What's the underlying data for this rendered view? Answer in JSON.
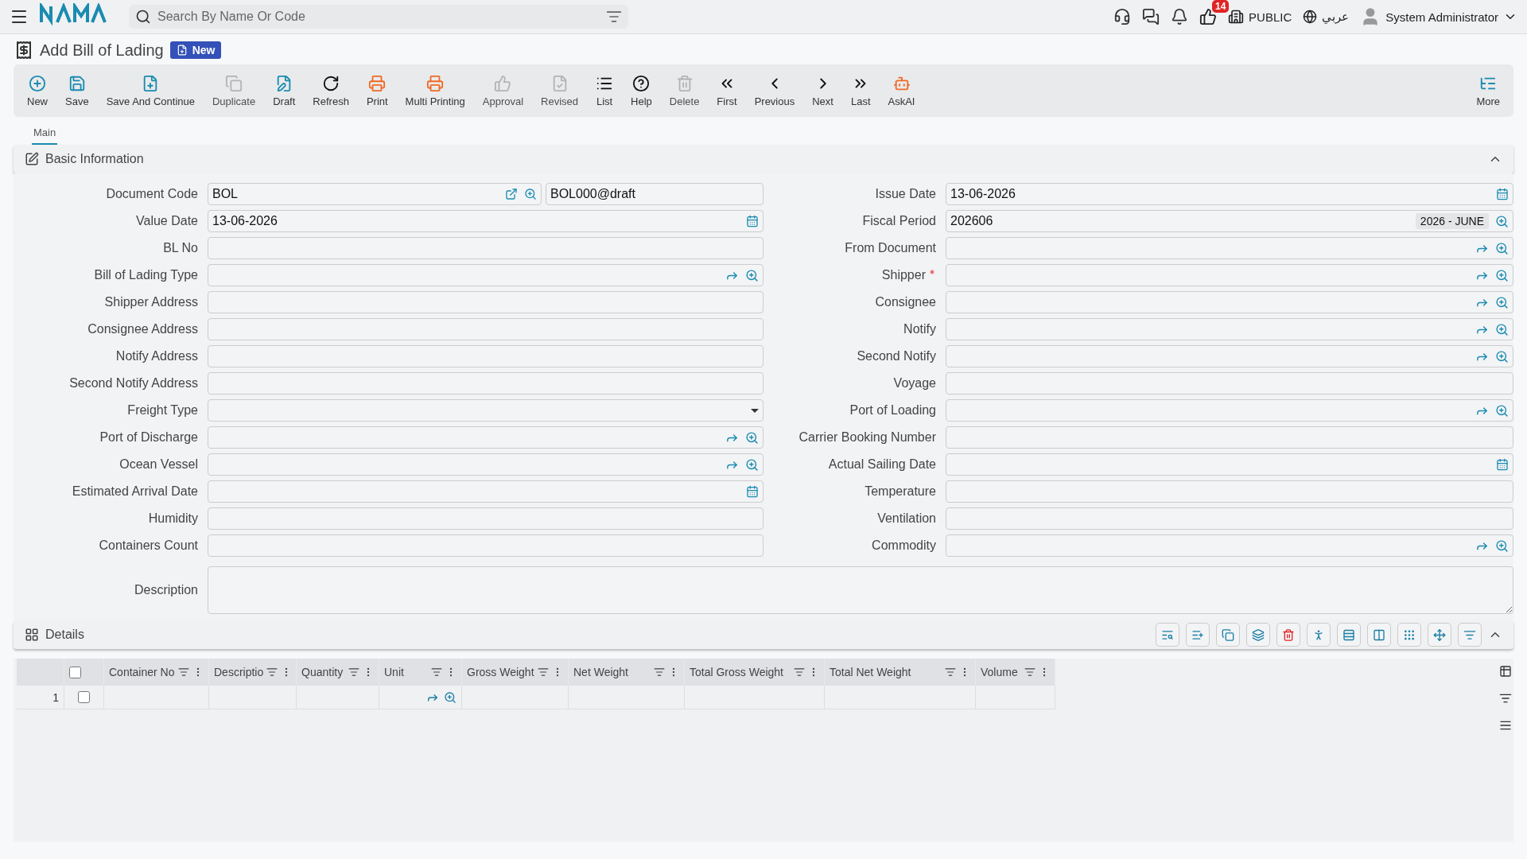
{
  "topbar": {
    "search": {
      "placeholder": "Search By Name Or Code"
    },
    "notifications_badge": "14",
    "branch": "PUBLIC",
    "language": "عربي",
    "user": "System Administrator"
  },
  "page": {
    "title": "Add Bill of Lading",
    "status": "New"
  },
  "toolbar": [
    {
      "label": "New",
      "disabled": false
    },
    {
      "label": "Save",
      "disabled": false
    },
    {
      "label": "Save And Continue",
      "disabled": false
    },
    {
      "label": "Duplicate",
      "disabled": true
    },
    {
      "label": "Draft",
      "disabled": false
    },
    {
      "label": "Refresh",
      "disabled": false
    },
    {
      "label": "Print",
      "disabled": false
    },
    {
      "label": "Multi Printing",
      "disabled": false
    },
    {
      "label": "Approval",
      "disabled": true
    },
    {
      "label": "Revised",
      "disabled": true
    },
    {
      "label": "List",
      "disabled": false
    },
    {
      "label": "Help",
      "disabled": false
    },
    {
      "label": "Delete",
      "disabled": true
    },
    {
      "label": "First",
      "disabled": false
    },
    {
      "label": "Previous",
      "disabled": false
    },
    {
      "label": "Next",
      "disabled": false
    },
    {
      "label": "Last",
      "disabled": false
    },
    {
      "label": "AskAI",
      "disabled": false
    }
  ],
  "more_button": "More",
  "tabs": [
    {
      "label": "Main",
      "selected": true
    }
  ],
  "basic_information": {
    "title": "Basic Information",
    "expanded": true,
    "left_fields": [
      {
        "label": "Document Code",
        "kind": "code",
        "value": "BOL",
        "value2": "BOL000@draft",
        "required": false
      },
      {
        "label": "Value Date",
        "kind": "date",
        "value": "13-06-2026",
        "required": false
      },
      {
        "label": "BL No",
        "kind": "text",
        "required": false
      },
      {
        "label": "Bill of Lading Type",
        "kind": "lookup",
        "required": false
      },
      {
        "label": "Shipper Address",
        "kind": "text",
        "required": false
      },
      {
        "label": "Consignee Address",
        "kind": "text",
        "required": false
      },
      {
        "label": "Notify Address",
        "kind": "text",
        "required": false
      },
      {
        "label": "Second Notify Address",
        "kind": "text",
        "required": false
      },
      {
        "label": "Freight Type",
        "kind": "select",
        "required": false
      },
      {
        "label": "Port of Discharge",
        "kind": "lookup",
        "required": false
      },
      {
        "label": "Ocean Vessel",
        "kind": "lookup",
        "required": false
      },
      {
        "label": "Estimated Arrival Date",
        "kind": "date",
        "required": false
      },
      {
        "label": "Humidity",
        "kind": "text",
        "required": false
      },
      {
        "label": "Containers Count",
        "kind": "text",
        "required": false
      }
    ],
    "right_fields": [
      {
        "label": "Issue Date",
        "kind": "date",
        "value": "13-06-2026",
        "required": false
      },
      {
        "label": "Fiscal Period",
        "kind": "period",
        "value": "202606",
        "tag": "2026 - JUNE",
        "required": false
      },
      {
        "label": "From Document",
        "kind": "lookup",
        "required": false
      },
      {
        "label": "Shipper",
        "kind": "lookup",
        "required": true
      },
      {
        "label": "Consignee",
        "kind": "lookup",
        "required": false
      },
      {
        "label": "Notify",
        "kind": "lookup",
        "required": false
      },
      {
        "label": "Second Notify",
        "kind": "lookup",
        "required": false
      },
      {
        "label": "Voyage",
        "kind": "text",
        "required": false
      },
      {
        "label": "Port of Loading",
        "kind": "lookup",
        "required": false
      },
      {
        "label": "Carrier Booking Number",
        "kind": "text",
        "required": false
      },
      {
        "label": "Actual Sailing Date",
        "kind": "date",
        "required": false
      },
      {
        "label": "Temperature",
        "kind": "text",
        "required": false
      },
      {
        "label": "Ventilation",
        "kind": "text",
        "required": false
      },
      {
        "label": "Commodity",
        "kind": "lookup",
        "required": false
      }
    ],
    "description_label": "Description"
  },
  "details": {
    "title": "Details",
    "expanded": true,
    "all_checked": false,
    "columns": [
      "Container No",
      "Descriptio",
      "Quantity",
      "Unit",
      "Gross Weight",
      "Net Weight",
      "Total Gross Weight",
      "Total Net Weight",
      "Volume"
    ],
    "rows": [
      {
        "number": "1",
        "checked": false
      }
    ]
  }
}
